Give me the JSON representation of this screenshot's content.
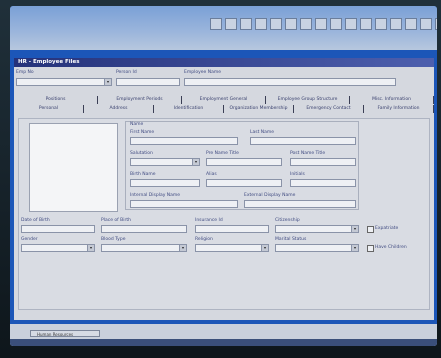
{
  "window": {
    "title": "HR - Employee Files"
  },
  "header": {
    "emp_no_label": "Emp No",
    "person_id_label": "Person Id",
    "employee_name_label": "Employee Name"
  },
  "tabs_row1": [
    "Positions",
    "Employment Periods",
    "Employment General",
    "Employee Group Structure",
    "Misc. Information"
  ],
  "tabs_row2": [
    "Personal",
    "Address",
    "Identification",
    "Organization Membership",
    "Emergency Contact",
    "Family Information"
  ],
  "name": {
    "section_label": "Name",
    "first_name": "First Name",
    "last_name": "Last Name",
    "salutation": "Salutation",
    "pre_name_title": "Pre Name Title",
    "post_name_title": "Post Name Title",
    "birth_name": "Birth Name",
    "alias": "Alias",
    "initials": "Initials",
    "internal_display_name": "Internal Display Name",
    "external_display_name": "External Display Name"
  },
  "personal": {
    "date_of_birth": "Date of Birth",
    "place_of_birth": "Place of Birth",
    "insurance_id": "Insurance Id",
    "citizenship": "Citizenship",
    "expatriate": "Expatriate",
    "gender": "Gender",
    "blood_type": "Blood Type",
    "religion": "Religion",
    "marital_status": "Marital Status",
    "have_children": "Have Children"
  },
  "status": {
    "task_label": "Human Resources"
  }
}
